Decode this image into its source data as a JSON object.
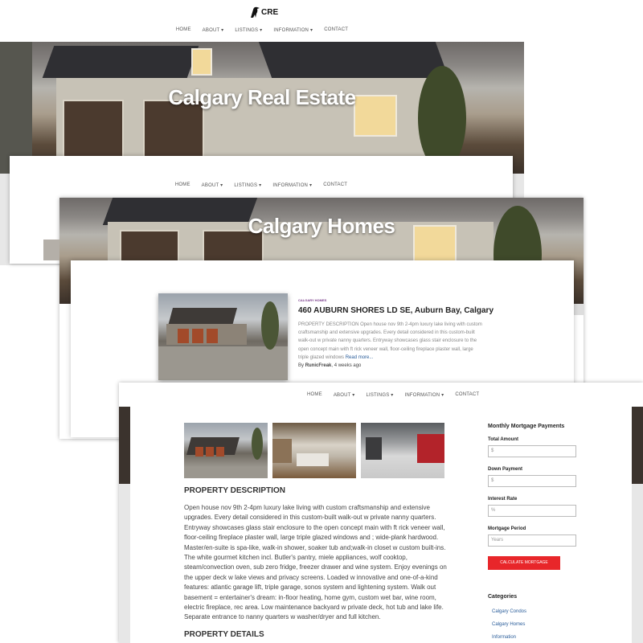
{
  "site": {
    "logo_text": "CRE"
  },
  "nav": {
    "items": [
      {
        "label": "HOME"
      },
      {
        "label": "ABOUT ▾"
      },
      {
        "label": "LISTINGS ▾"
      },
      {
        "label": "INFORMATION ▾"
      },
      {
        "label": "CONTACT"
      }
    ]
  },
  "page1": {
    "hero_title": "Calgary Real Estate"
  },
  "page2": {
    "hero_title": "Calgary Homes"
  },
  "post": {
    "category": "CALGARY HOMES",
    "title": "460 AUBURN SHORES LD SE, Auburn Bay, Calgary",
    "excerpt": "PROPERTY DESCRIPTION Open house nov 9th 2-4pm luxury lake living with custom craftsmanship and extensive upgrades. Every detail considered in this custom-built walk-out w private nanny quarters. Entryway showcases glass stair enclosure to the open concept main with ft rick veneer wall, floor-ceiling fireplace plaster wall, large triple glazed windows",
    "read_more": "Read more...",
    "by_label": "By",
    "author": "RunicFreak",
    "time": ", 4 weeks ago"
  },
  "listing": {
    "desc_heading": "PROPERTY DESCRIPTION",
    "description": "Open house nov 9th 2-4pm luxury lake living with custom craftsmanship and extensive upgrades. Every detail considered in this custom-built walk-out w private nanny quarters. Entryway showcases glass stair enclosure to the open concept main with ft rick veneer wall, floor-ceiling fireplace plaster wall, large triple glazed windows and ; wide-plank hardwood. Master/en-suite is spa-like, walk-in shower, soaker tub and;walk-in closet w custom built-ins. The white gourmet kitchen incl. Butler's pantry, miele appliances, wolf cooktop, steam/convection oven, sub zero fridge, freezer drawer and wine system. Enjoy evenings on the upper deck w lake views and privacy screens. Loaded w innovative and one-of-a-kind features: atlantic garage lift, triple garage, sonos system and lightening system. Walk out basement = entertainer's dream: in-floor heating, home gym, custom wet bar, wine room, electric fireplace, rec area. Low maintenance backyard w private deck, hot tub and lake life. Separate entrance to nanny quarters w washer/dryer and full kitchen.",
    "details_heading": "PROPERTY DETAILS"
  },
  "mortgage": {
    "heading": "Monthly Mortgage Payments",
    "total_label": "Total Amount",
    "total_placeholder": "$",
    "down_label": "Down Payment",
    "down_placeholder": "$",
    "rate_label": "Interest Rate",
    "rate_placeholder": "%",
    "period_label": "Mortgage Period",
    "period_placeholder": "Years",
    "button": "CALCULATE MORTGAGE"
  },
  "categories": {
    "heading": "Categories",
    "items": [
      {
        "label": "Calgary Condos"
      },
      {
        "label": "Calgary Homes"
      },
      {
        "label": "Information"
      }
    ]
  },
  "colors": {
    "button_red": "#e8262a",
    "link_blue": "#2a5d9a",
    "category_purple": "#7a3d8c"
  }
}
